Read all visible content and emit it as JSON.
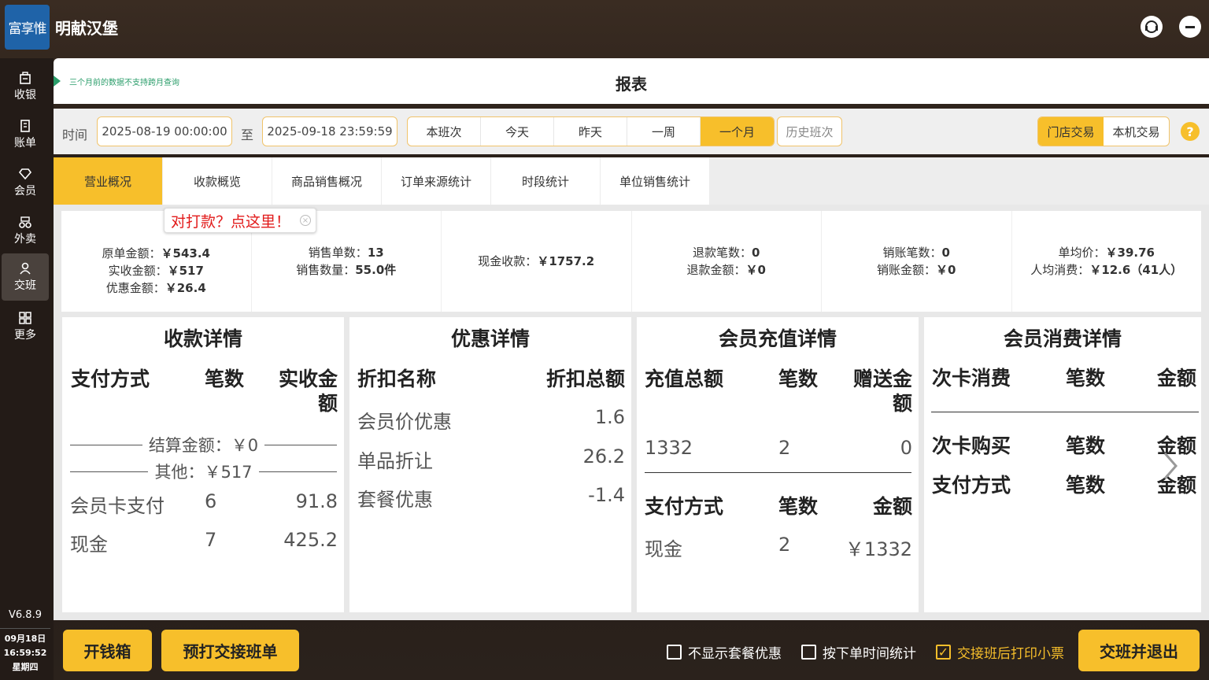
{
  "app": {
    "logo_text": "富享惟",
    "store_name": "明献汉堡"
  },
  "topicons": [
    {
      "name": "support-icon"
    },
    {
      "name": "minimize-icon"
    }
  ],
  "sidebar": {
    "items": [
      {
        "label": "收银",
        "icon": "register-icon"
      },
      {
        "label": "账单",
        "icon": "bill-icon"
      },
      {
        "label": "会员",
        "icon": "diamond-icon"
      },
      {
        "label": "外卖",
        "icon": "delivery-icon"
      },
      {
        "label": "交班",
        "icon": "handover-icon",
        "active": true
      },
      {
        "label": "更多",
        "icon": "grid-icon"
      }
    ],
    "version": "V6.8.9",
    "date": "09月18日",
    "time": "16:59:52",
    "weekday": "星期四"
  },
  "header": {
    "hint": "三个月前的数据不支持跨月查询",
    "title": "报表"
  },
  "filter": {
    "time_label": "时间",
    "start": "2025-08-19 00:00:00",
    "to_label": "至",
    "end": "2025-09-18 23:59:59",
    "ranges": [
      "本班次",
      "今天",
      "昨天",
      "一周",
      "一个月"
    ],
    "selected_range": "一个月",
    "history": "历史班次",
    "scopes": [
      "门店交易",
      "本机交易"
    ],
    "selected_scope": "门店交易",
    "help": "?"
  },
  "tabs": [
    "营业概况",
    "收款概览",
    "商品销售概况",
    "订单来源统计",
    "时段统计",
    "单位销售统计"
  ],
  "selected_tab": "营业概况",
  "tooltip": {
    "text": "对打款？点这里！",
    "close": "×"
  },
  "summary": {
    "orig_label": "原单金额：",
    "orig": "￥543.4",
    "paid_label": "实收金额：",
    "paid": "￥517",
    "disc_label": "优惠金额：",
    "disc": "￥26.4",
    "orders_label": "销售单数：",
    "orders": "13",
    "qty_label": "销售数量：",
    "qty": "55.0件",
    "cash_label": "现金收款：",
    "cash": "￥1757.2",
    "refund_count_label": "退款笔数：",
    "refund_count": "0",
    "refund_amount_label": "退款金额：",
    "refund_amount": "￥0",
    "void_count_label": "销账笔数：",
    "void_count": "0",
    "void_amount_label": "销账金额：",
    "void_amount": "￥0",
    "avg_label": "单均价：",
    "avg": "￥39.76",
    "per_label": "人均消费：",
    "per": "￥12.6（41人）"
  },
  "cards": {
    "payment": {
      "title": "收款详情",
      "headers": [
        "支付方式",
        "笔数",
        "实收金额"
      ],
      "settle_label": "结算金额：￥0",
      "other_label": "其他：￥517",
      "rows": [
        [
          "会员卡支付",
          "6",
          "91.8"
        ],
        [
          "现金",
          "7",
          "425.2"
        ]
      ]
    },
    "discount": {
      "title": "优惠详情",
      "headers": [
        "折扣名称",
        "折扣总额"
      ],
      "rows": [
        [
          "会员价优惠",
          "1.6"
        ],
        [
          "单品折让",
          "26.2"
        ],
        [
          "套餐优惠",
          "-1.4"
        ]
      ]
    },
    "recharge": {
      "title": "会员充值详情",
      "headers": [
        "充值总额",
        "笔数",
        "赠送金额"
      ],
      "row": [
        "1332",
        "2",
        "0"
      ],
      "headers2": [
        "支付方式",
        "笔数",
        "金额"
      ],
      "row2": [
        "现金",
        "2",
        "￥1332"
      ]
    },
    "consume": {
      "title": "会员消费详情",
      "headers": [
        "次卡消费",
        "笔数",
        "金额"
      ],
      "headers2": [
        "次卡购买",
        "笔数",
        "金额"
      ],
      "headers3": [
        "支付方式",
        "笔数",
        "金额"
      ]
    }
  },
  "bottom": {
    "open_drawer": "开钱箱",
    "preprint": "预打交接班单",
    "opt1": "不显示套餐优惠",
    "opt2": "按下单时间统计",
    "opt3": "交接班后打印小票",
    "opt3_checked": true,
    "submit": "交班并退出"
  },
  "colors": {
    "accent": "#f7bf2b",
    "logo": "#1f63a8",
    "tip": "#e21b1b",
    "hint": "#2a9d6a"
  }
}
